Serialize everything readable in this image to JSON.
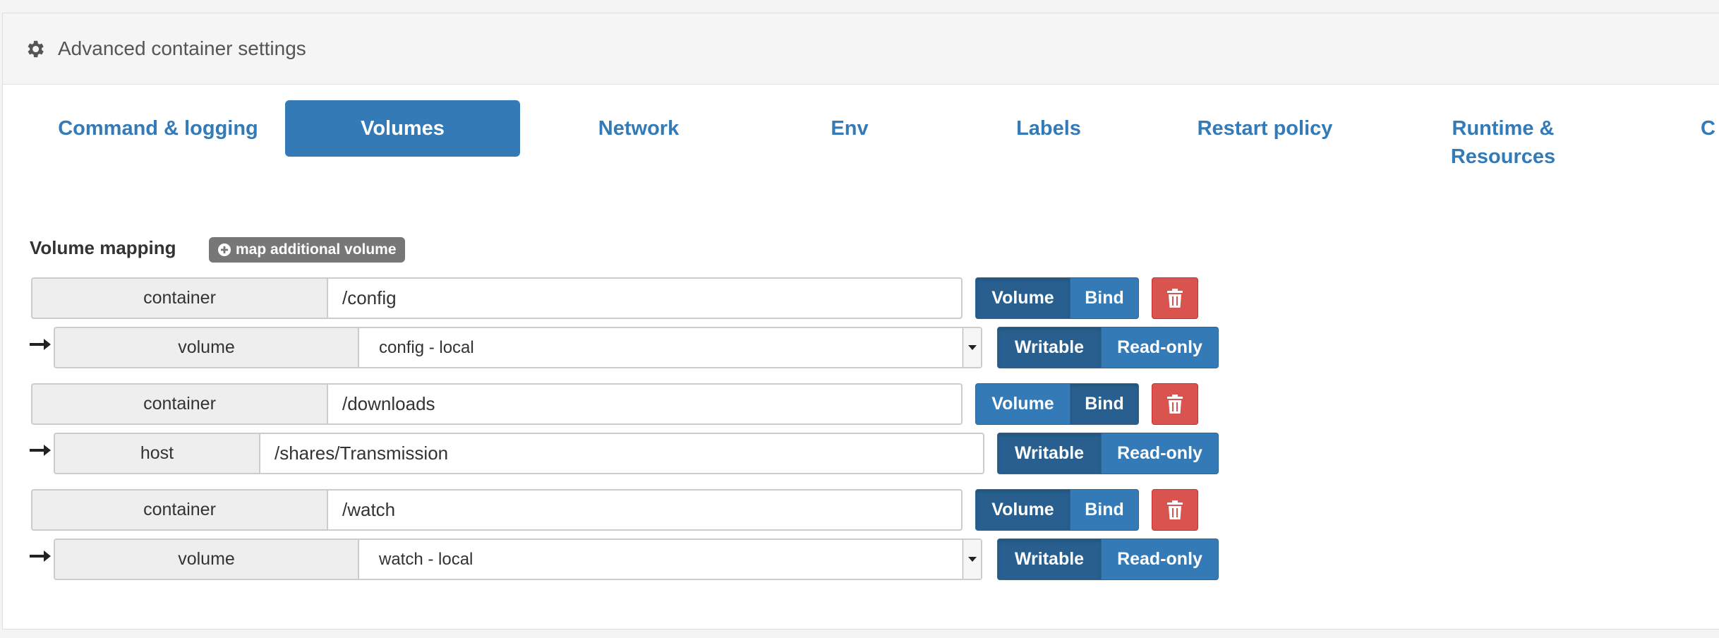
{
  "header": {
    "title": "Advanced container settings",
    "icon": "gear-icon"
  },
  "tabs": [
    {
      "label": "Command & logging"
    },
    {
      "label": "Volumes"
    },
    {
      "label": "Network"
    },
    {
      "label": "Env"
    },
    {
      "label": "Labels"
    },
    {
      "label": "Restart policy"
    },
    {
      "label": "Runtime &",
      "label2": "Resources"
    },
    {
      "label": "C"
    }
  ],
  "volumes": {
    "title": "Volume mapping",
    "add_label": "map additional volume",
    "mappings": [
      {
        "container_label": "container",
        "container_path": "/config",
        "type_volume": "Volume",
        "type_bind": "Bind",
        "target_label": "volume",
        "target_value": "config - local",
        "mode_writable": "Writable",
        "mode_readonly": "Read-only"
      },
      {
        "container_label": "container",
        "container_path": "/downloads",
        "type_volume": "Volume",
        "type_bind": "Bind",
        "target_label": "host",
        "target_value": "/shares/Transmission",
        "mode_writable": "Writable",
        "mode_readonly": "Read-only"
      },
      {
        "container_label": "container",
        "container_path": "/watch",
        "type_volume": "Volume",
        "type_bind": "Bind",
        "target_label": "volume",
        "target_value": "watch - local",
        "mode_writable": "Writable",
        "mode_readonly": "Read-only"
      }
    ]
  },
  "colors": {
    "primary": "#337ab7",
    "primary_active": "#285f8f",
    "danger": "#d9534f"
  }
}
